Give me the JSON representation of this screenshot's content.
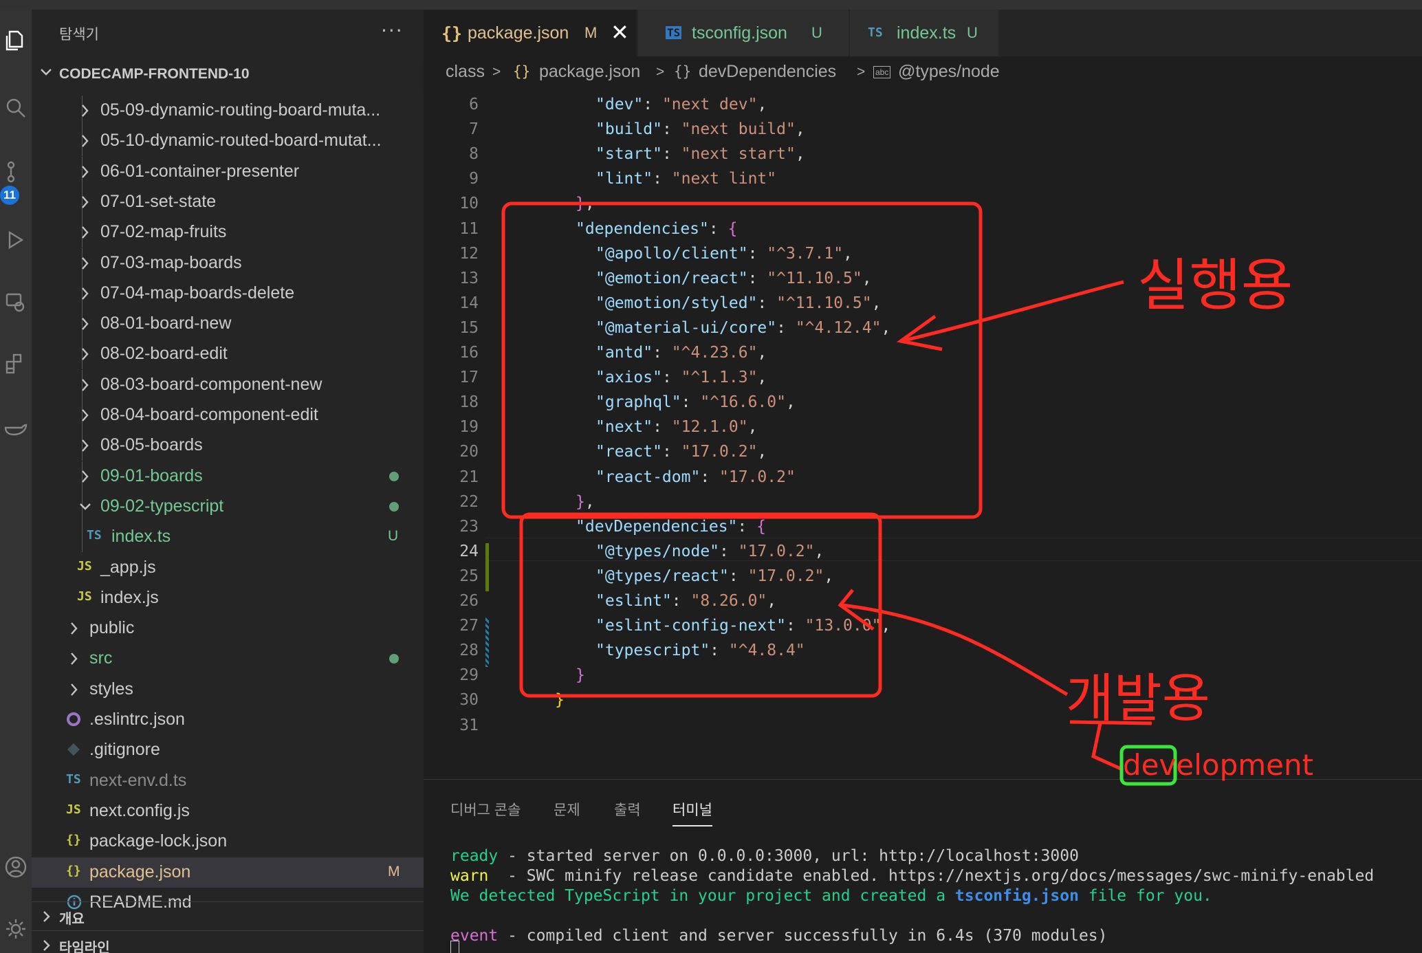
{
  "sidebar": {
    "title": "탐색기",
    "more": "···",
    "root": "CODECAMP-FRONTEND-10",
    "items": [
      {
        "label": "05-09-dynamic-routing-board-muta...",
        "kind": "folder",
        "color": "default"
      },
      {
        "label": "05-10-dynamic-routed-board-mutat...",
        "kind": "folder",
        "color": "default"
      },
      {
        "label": "06-01-container-presenter",
        "kind": "folder",
        "color": "default"
      },
      {
        "label": "07-01-set-state",
        "kind": "folder",
        "color": "default"
      },
      {
        "label": "07-02-map-fruits",
        "kind": "folder",
        "color": "default"
      },
      {
        "label": "07-03-map-boards",
        "kind": "folder",
        "color": "default"
      },
      {
        "label": "07-04-map-boards-delete",
        "kind": "folder",
        "color": "default"
      },
      {
        "label": "08-01-board-new",
        "kind": "folder",
        "color": "default"
      },
      {
        "label": "08-02-board-edit",
        "kind": "folder",
        "color": "default"
      },
      {
        "label": "08-03-board-component-new",
        "kind": "folder",
        "color": "default"
      },
      {
        "label": "08-04-board-component-edit",
        "kind": "folder",
        "color": "default"
      },
      {
        "label": "08-05-boards",
        "kind": "folder",
        "color": "default"
      },
      {
        "label": "09-01-boards",
        "kind": "folder",
        "color": "green"
      },
      {
        "label": "09-02-typescript",
        "kind": "folder-open",
        "color": "green"
      },
      {
        "label": "index.ts",
        "kind": "ts",
        "color": "green",
        "status": "U"
      },
      {
        "label": "_app.js",
        "kind": "js",
        "color": "default"
      },
      {
        "label": "index.js",
        "kind": "js",
        "color": "default"
      },
      {
        "label": "public",
        "kind": "folder",
        "color": "default"
      },
      {
        "label": "src",
        "kind": "folder",
        "color": "green"
      },
      {
        "label": "styles",
        "kind": "folder",
        "color": "default"
      },
      {
        "label": ".eslintrc.json",
        "kind": "eslint",
        "color": "default"
      },
      {
        "label": ".gitignore",
        "kind": "git",
        "color": "default"
      },
      {
        "label": "next-env.d.ts",
        "kind": "ts",
        "color": "gray"
      },
      {
        "label": "next.config.js",
        "kind": "js",
        "color": "default"
      },
      {
        "label": "package-lock.json",
        "kind": "json",
        "color": "default"
      },
      {
        "label": "package.json",
        "kind": "json",
        "color": "yellow",
        "status": "M"
      },
      {
        "label": "README.md",
        "kind": "info",
        "color": "default"
      }
    ],
    "outline": "개요",
    "timeline": "타임라인",
    "activity_badge": "11"
  },
  "icons": {
    "ts": "TS",
    "js": "JS",
    "json": "{}"
  },
  "tabs": [
    {
      "icon": "{}",
      "label": "package.json",
      "status": "M",
      "close": "✕"
    },
    {
      "icon": "TS",
      "label": "tsconfig.json",
      "status": "U"
    },
    {
      "icon": "TS",
      "label": "index.ts",
      "status": "U"
    }
  ],
  "breadcrumb": {
    "c1": "class",
    "sep": ">",
    "c2_icon": "{}",
    "c2": "package.json",
    "c3_icon": "{}",
    "c3": "devDependencies",
    "c4_icon": "abc",
    "c4": "@types/node"
  },
  "editor": {
    "line_numbers": [
      "6",
      "7",
      "8",
      "9",
      "10",
      "11",
      "12",
      "13",
      "14",
      "15",
      "16",
      "17",
      "18",
      "19",
      "20",
      "21",
      "22",
      "23",
      "24",
      "25",
      "26",
      "27",
      "28",
      "29",
      "30",
      "31"
    ],
    "scripts": [
      {
        "key": "\"dev\"",
        "val": "\"next dev\"",
        "tail": ","
      },
      {
        "key": "\"build\"",
        "val": "\"next build\"",
        "tail": ","
      },
      {
        "key": "\"start\"",
        "val": "\"next start\"",
        "tail": ","
      },
      {
        "key": "\"lint\"",
        "val": "\"next lint\"",
        "tail": ""
      }
    ],
    "dependencies_key": "\"dependencies\"",
    "dependencies": [
      {
        "key": "\"@apollo/client\"",
        "val": "\"^3.7.1\"",
        "tail": ","
      },
      {
        "key": "\"@emotion/react\"",
        "val": "\"^11.10.5\"",
        "tail": ","
      },
      {
        "key": "\"@emotion/styled\"",
        "val": "\"^11.10.5\"",
        "tail": ","
      },
      {
        "key": "\"@material-ui/core\"",
        "val": "\"^4.12.4\"",
        "tail": ","
      },
      {
        "key": "\"antd\"",
        "val": "\"^4.23.6\"",
        "tail": ","
      },
      {
        "key": "\"axios\"",
        "val": "\"^1.1.3\"",
        "tail": ","
      },
      {
        "key": "\"graphql\"",
        "val": "\"^16.6.0\"",
        "tail": ","
      },
      {
        "key": "\"next\"",
        "val": "\"12.1.0\"",
        "tail": ","
      },
      {
        "key": "\"react\"",
        "val": "\"17.0.2\"",
        "tail": ","
      },
      {
        "key": "\"react-dom\"",
        "val": "\"17.0.2\"",
        "tail": ""
      }
    ],
    "devdependencies_key": "\"devDependencies\"",
    "devdependencies": [
      {
        "key": "\"@types/node\"",
        "val": "\"17.0.2\"",
        "tail": ","
      },
      {
        "key": "\"@types/react\"",
        "val": "\"17.0.2\"",
        "tail": ","
      },
      {
        "key": "\"eslint\"",
        "val": "\"8.26.0\"",
        "tail": ","
      },
      {
        "key": "\"eslint-config-next\"",
        "val": "\"13.0.0\"",
        "tail": ","
      },
      {
        "key": "\"typescript\"",
        "val": "\"^4.8.4\"",
        "tail": ""
      }
    ]
  },
  "annotations": {
    "runtime_label": "실행용",
    "dev_label": "개발용",
    "dev_word_head": "dev",
    "dev_word_tail": "elopment",
    "red": "#ff2a20",
    "green": "#39e639"
  },
  "panel": {
    "tabs": [
      "디버그 콘솔",
      "문제",
      "출력",
      "터미널"
    ],
    "active_tab": "터미널",
    "lines": [
      {
        "prefix": "ready",
        "prefix_pad": " ",
        "text": "- started server on 0.0.0.0:3000, url: http://localhost:3000"
      },
      {
        "prefix": "warn",
        "prefix_pad": "  ",
        "text": "- SWC minify release candidate enabled. https://nextjs.org/docs/messages/swc-minify-enabled"
      },
      {
        "plain_start": "We detected TypeScript in your project and created a ",
        "bold": "tsconfig.json",
        "plain_end": " file for you."
      },
      {
        "prefix": "event",
        "prefix_pad": " ",
        "text": "- compiled client and server successfully in 6.4s (370 modules)"
      }
    ]
  }
}
